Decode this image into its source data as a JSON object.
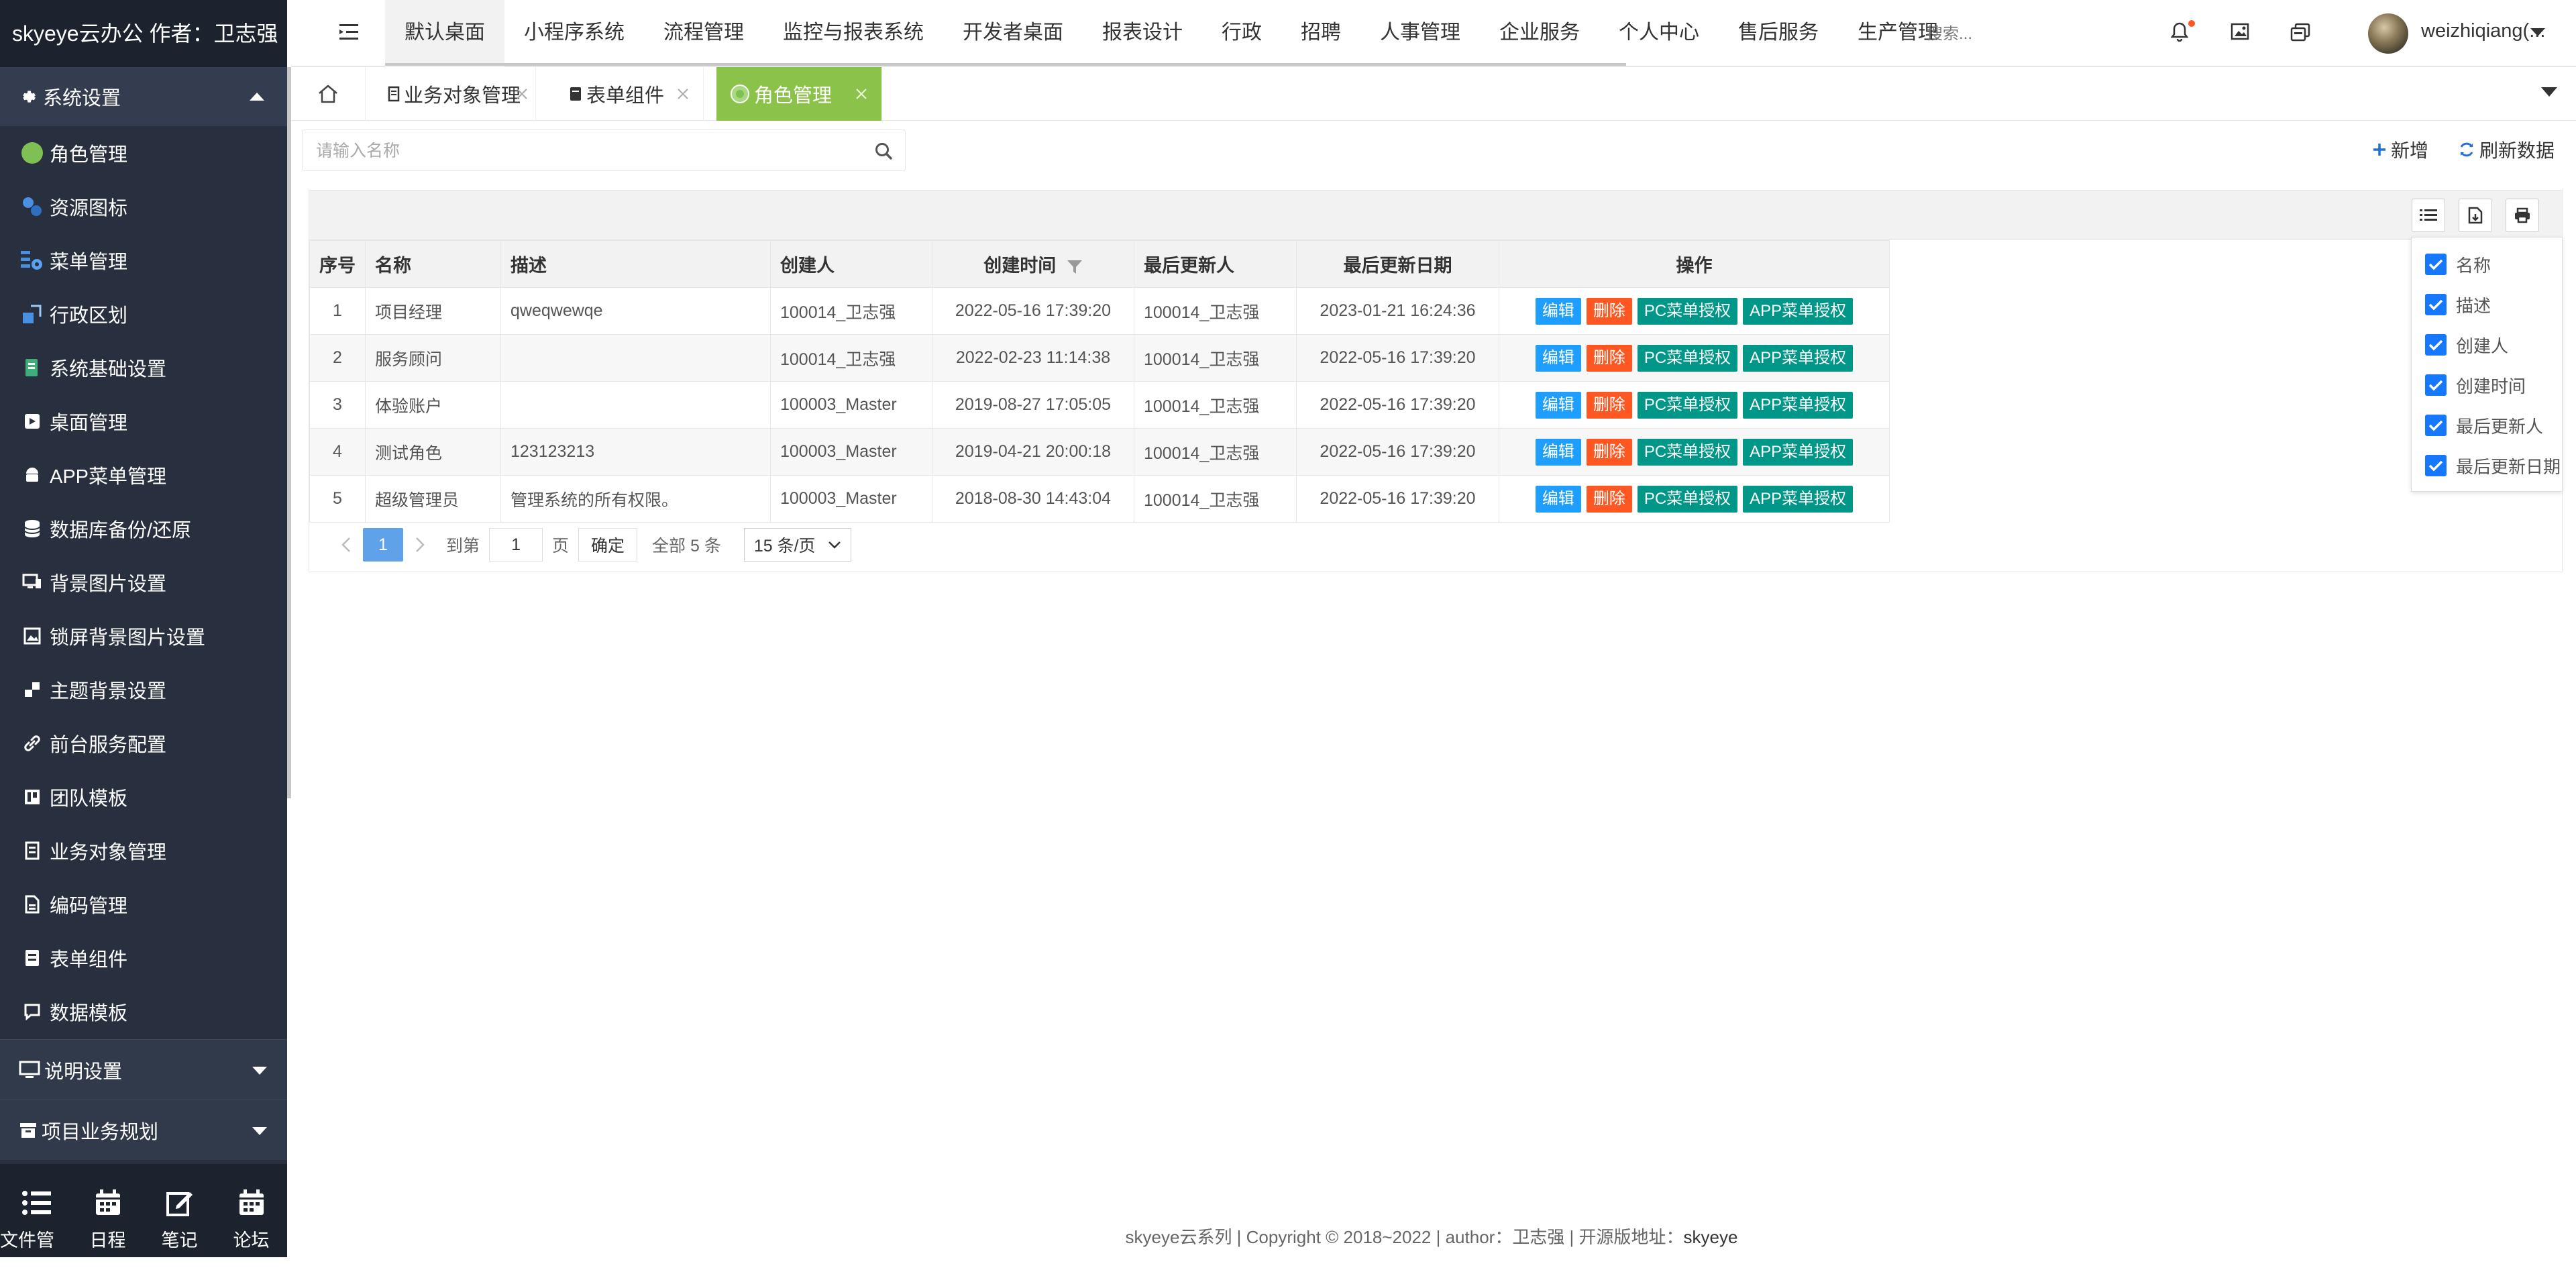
{
  "brand": "skyeye云办公 作者：卫志强",
  "sidebar": {
    "group_system": "系统设置",
    "items": [
      {
        "label": "角色管理"
      },
      {
        "label": "资源图标"
      },
      {
        "label": "菜单管理"
      },
      {
        "label": "行政区划"
      },
      {
        "label": "系统基础设置"
      },
      {
        "label": "桌面管理"
      },
      {
        "label": "APP菜单管理"
      },
      {
        "label": "数据库备份/还原"
      },
      {
        "label": "背景图片设置"
      },
      {
        "label": "锁屏背景图片设置"
      },
      {
        "label": "主题背景设置"
      },
      {
        "label": "前台服务配置"
      },
      {
        "label": "团队模板"
      },
      {
        "label": "业务对象管理"
      },
      {
        "label": "编码管理"
      },
      {
        "label": "表单组件"
      },
      {
        "label": "数据模板"
      }
    ],
    "group_explain": "说明设置",
    "group_project": "项目业务规划",
    "tools": [
      "文件管理",
      "日程",
      "笔记",
      "论坛"
    ]
  },
  "topnav": {
    "items": [
      "默认桌面",
      "小程序系统",
      "流程管理",
      "监控与报表系统",
      "开发者桌面",
      "报表设计",
      "行政",
      "招聘",
      "人事管理",
      "企业服务",
      "个人中心",
      "售后服务",
      "生产管理"
    ],
    "active_index": 0,
    "search_placeholder": "搜索...",
    "username": "weizhiqiang(..."
  },
  "tabs": {
    "items": [
      "业务对象管理",
      "表单组件",
      "角色管理"
    ],
    "active_index": 2
  },
  "toolbar": {
    "search_placeholder": "请输入名称",
    "add_label": "新增",
    "refresh_label": "刷新数据"
  },
  "table": {
    "columns": [
      "序号",
      "名称",
      "描述",
      "创建人",
      "创建时间",
      "最后更新人",
      "最后更新日期",
      "操作"
    ],
    "rows": [
      {
        "no": "1",
        "name": "项目经理",
        "desc": "qweqwewqe",
        "creator": "100014_卫志强",
        "created": "2022-05-16 17:39:20",
        "updater": "100014_卫志强",
        "updated": "2023-01-21 16:24:36"
      },
      {
        "no": "2",
        "name": "服务顾问",
        "desc": "",
        "creator": "100014_卫志强",
        "created": "2022-02-23 11:14:38",
        "updater": "100014_卫志强",
        "updated": "2022-05-16 17:39:20"
      },
      {
        "no": "3",
        "name": "体验账户",
        "desc": "",
        "creator": "100003_Master",
        "created": "2019-08-27 17:05:05",
        "updater": "100014_卫志强",
        "updated": "2022-05-16 17:39:20"
      },
      {
        "no": "4",
        "name": "测试角色",
        "desc": "123123213",
        "creator": "100003_Master",
        "created": "2019-04-21 20:00:18",
        "updater": "100014_卫志强",
        "updated": "2022-05-16 17:39:20"
      },
      {
        "no": "5",
        "name": "超级管理员",
        "desc": "管理系统的所有权限。",
        "creator": "100003_Master",
        "created": "2018-08-30 14:43:04",
        "updater": "100014_卫志强",
        "updated": "2022-05-16 17:39:20"
      }
    ],
    "actions": {
      "edit": "编辑",
      "delete": "删除",
      "pc": "PC菜单授权",
      "app": "APP菜单授权"
    }
  },
  "pager": {
    "current": "1",
    "goto_label": "到第",
    "goto_value": "1",
    "page_unit": "页",
    "confirm": "确定",
    "total": "全部 5 条",
    "per_page": "15 条/页"
  },
  "column_panel": {
    "options": [
      "名称",
      "描述",
      "创建人",
      "创建时间",
      "最后更新人",
      "最后更新日期"
    ]
  },
  "footer": {
    "text": "skyeye云系列 | Copyright © 2018~2022 | author：卫志强 | 开源版地址：",
    "link": "skyeye"
  },
  "colors": {
    "sidebar_bg": "#28303f",
    "brand_bg": "#1d232e",
    "active_tab": "#8bc34a",
    "edit": "#1e9fff",
    "delete": "#ff5722",
    "auth": "#009688",
    "checkbox": "#1677ff"
  }
}
